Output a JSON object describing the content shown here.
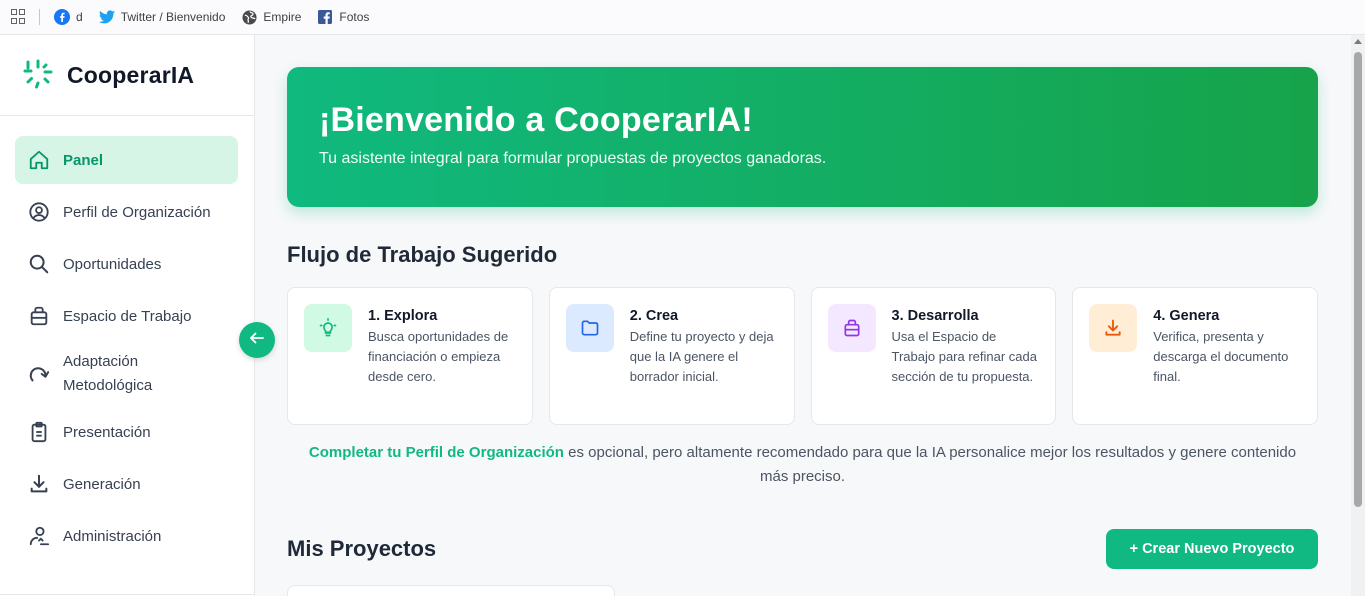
{
  "bookmarks": [
    {
      "label": "d",
      "icon": "facebook-icon"
    },
    {
      "label": "Twitter / Bienvenido",
      "icon": "twitter-icon"
    },
    {
      "label": "Empire",
      "icon": "globe-icon"
    },
    {
      "label": "Fotos",
      "icon": "facebook-square-icon"
    }
  ],
  "brand": {
    "name": "CooperarIA"
  },
  "nav": [
    {
      "label": "Panel",
      "icon": "home-icon",
      "active": true
    },
    {
      "label": "Perfil de Organización",
      "icon": "user-circle-icon"
    },
    {
      "label": "Oportunidades",
      "icon": "search-icon"
    },
    {
      "label": "Espacio de Trabajo",
      "icon": "briefcase-icon"
    },
    {
      "label": "Adaptación Metodológica",
      "icon": "redo-icon"
    },
    {
      "label": "Presentación",
      "icon": "clipboard-icon"
    },
    {
      "label": "Generación",
      "icon": "download-icon"
    },
    {
      "label": "Administración",
      "icon": "user-settings-icon"
    }
  ],
  "hero": {
    "title": "¡Bienvenido a CooperarIA!",
    "subtitle": "Tu asistente integral para formular propuestas de proyectos ganadoras."
  },
  "workflow": {
    "title": "Flujo de Trabajo Sugerido",
    "steps": [
      {
        "title": "1. Explora",
        "desc": "Busca oportunidades de financiación o empieza desde cero.",
        "icon": "lightbulb-icon",
        "color": "#10b981",
        "bg": "#d1fae5"
      },
      {
        "title": "2. Crea",
        "desc": "Define tu proyecto y deja que la IA genere el borrador inicial.",
        "icon": "folder-icon",
        "color": "#2563eb",
        "bg": "#dbeafe"
      },
      {
        "title": "3. Desarrolla",
        "desc": "Usa el Espacio de Trabajo para refinar cada sección de tu propuesta.",
        "icon": "briefcase-icon",
        "color": "#9333ea",
        "bg": "#f3e8ff"
      },
      {
        "title": "4. Genera",
        "desc": "Verifica, presenta y descarga el documento final.",
        "icon": "download-icon",
        "color": "#ea580c",
        "bg": "#ffedd5"
      }
    ]
  },
  "note": {
    "link": "Completar tu Perfil de Organización",
    "text": " es opcional, pero altamente recomendado para que la IA personalice mejor los resultados y genere contenido más preciso."
  },
  "projects": {
    "title": "Mis Proyectos",
    "create_label": "+ Crear Nuevo Proyecto"
  },
  "colors": {
    "accent": "#10b981",
    "accent_dark": "#16a34a"
  }
}
